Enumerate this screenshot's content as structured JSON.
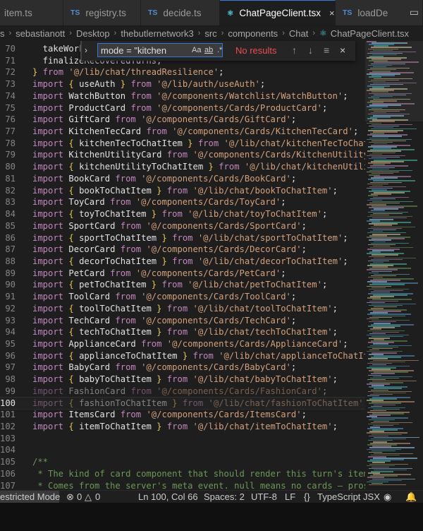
{
  "tabs": [
    {
      "label": "item.ts",
      "active": false
    },
    {
      "label": "registry.ts",
      "active": false
    },
    {
      "label": "decide.ts",
      "active": false
    },
    {
      "label": "ChatPageClient.tsx",
      "active": true
    },
    {
      "label": "loadDe",
      "active": false
    }
  ],
  "tab_close_glyph": "×",
  "breadcrumb": [
    "s",
    "sebastianott",
    "Desktop",
    "thebutlernetwork3",
    "src",
    "components",
    "Chat",
    "ChatPageClient.tsx"
  ],
  "find": {
    "query": "mode = \"kitchen",
    "result": "No results",
    "opt_case": "Aa",
    "opt_word": "ab",
    "opt_regex": ".*"
  },
  "lines": [
    {
      "n": 70,
      "code": [
        [
          "id",
          "  takeWork"
        ]
      ]
    },
    {
      "n": 71,
      "code": [
        [
          "id",
          "  finalizeRecoveredTurns,"
        ]
      ]
    },
    {
      "n": 72,
      "code": [
        [
          "br",
          "}"
        ],
        [
          "kw",
          " from "
        ],
        [
          "str",
          "'@/lib/chat/threadResilience'"
        ],
        [
          "id",
          ";"
        ]
      ]
    },
    {
      "n": 73,
      "code": [
        [
          "kw",
          "import "
        ],
        [
          "br",
          "{ "
        ],
        [
          "id",
          "useAuth "
        ],
        [
          "br",
          "}"
        ],
        [
          "kw",
          " from "
        ],
        [
          "str",
          "'@/lib/auth/useAuth'"
        ],
        [
          "id",
          ";"
        ]
      ]
    },
    {
      "n": 74,
      "code": [
        [
          "kw",
          "import "
        ],
        [
          "id",
          "WatchButton "
        ],
        [
          "kw",
          "from "
        ],
        [
          "str",
          "'@/components/Watchlist/WatchButton'"
        ],
        [
          "id",
          ";"
        ]
      ]
    },
    {
      "n": 75,
      "code": [
        [
          "kw",
          "import "
        ],
        [
          "id",
          "ProductCard "
        ],
        [
          "kw",
          "from "
        ],
        [
          "str",
          "'@/components/Cards/ProductCard'"
        ],
        [
          "id",
          ";"
        ]
      ]
    },
    {
      "n": 76,
      "code": [
        [
          "kw",
          "import "
        ],
        [
          "id",
          "GiftCard "
        ],
        [
          "kw",
          "from "
        ],
        [
          "str",
          "'@/components/Cards/GiftCard'"
        ],
        [
          "id",
          ";"
        ]
      ]
    },
    {
      "n": 77,
      "code": [
        [
          "kw",
          "import "
        ],
        [
          "id",
          "KitchenTecCard "
        ],
        [
          "kw",
          "from "
        ],
        [
          "str",
          "'@/components/Cards/KitchenTecCard'"
        ],
        [
          "id",
          ";"
        ]
      ]
    },
    {
      "n": 78,
      "code": [
        [
          "kw",
          "import "
        ],
        [
          "br",
          "{ "
        ],
        [
          "id",
          "kitchenTecToChatItem "
        ],
        [
          "br",
          "}"
        ],
        [
          "kw",
          " from "
        ],
        [
          "str",
          "'@/lib/chat/kitchenTecToChatItem'"
        ]
      ]
    },
    {
      "n": 79,
      "code": [
        [
          "kw",
          "import "
        ],
        [
          "id",
          "KitchenUtilityCard "
        ],
        [
          "kw",
          "from "
        ],
        [
          "str",
          "'@/components/Cards/KitchenUtilityCard'"
        ]
      ]
    },
    {
      "n": 80,
      "code": [
        [
          "kw",
          "import "
        ],
        [
          "br",
          "{ "
        ],
        [
          "id",
          "kitchenUtilityToChatItem "
        ],
        [
          "br",
          "}"
        ],
        [
          "kw",
          " from "
        ],
        [
          "str",
          "'@/lib/chat/kitchenUtilityToC"
        ]
      ]
    },
    {
      "n": 81,
      "code": [
        [
          "kw",
          "import "
        ],
        [
          "id",
          "BookCard "
        ],
        [
          "kw",
          "from "
        ],
        [
          "str",
          "'@/components/Cards/BookCard'"
        ],
        [
          "id",
          ";"
        ]
      ]
    },
    {
      "n": 82,
      "code": [
        [
          "kw",
          "import "
        ],
        [
          "br",
          "{ "
        ],
        [
          "id",
          "bookToChatItem "
        ],
        [
          "br",
          "}"
        ],
        [
          "kw",
          " from "
        ],
        [
          "str",
          "'@/lib/chat/bookToChatItem'"
        ],
        [
          "id",
          ";"
        ]
      ]
    },
    {
      "n": 83,
      "code": [
        [
          "kw",
          "import "
        ],
        [
          "id",
          "ToyCard "
        ],
        [
          "kw",
          "from "
        ],
        [
          "str",
          "'@/components/Cards/ToyCard'"
        ],
        [
          "id",
          ";"
        ]
      ]
    },
    {
      "n": 84,
      "code": [
        [
          "kw",
          "import "
        ],
        [
          "br",
          "{ "
        ],
        [
          "id",
          "toyToChatItem "
        ],
        [
          "br",
          "}"
        ],
        [
          "kw",
          " from "
        ],
        [
          "str",
          "'@/lib/chat/toyToChatItem'"
        ],
        [
          "id",
          ";"
        ]
      ]
    },
    {
      "n": 85,
      "code": [
        [
          "kw",
          "import "
        ],
        [
          "id",
          "SportCard "
        ],
        [
          "kw",
          "from "
        ],
        [
          "str",
          "'@/components/Cards/SportCard'"
        ],
        [
          "id",
          ";"
        ]
      ]
    },
    {
      "n": 86,
      "code": [
        [
          "kw",
          "import "
        ],
        [
          "br",
          "{ "
        ],
        [
          "id",
          "sportToChatItem "
        ],
        [
          "br",
          "}"
        ],
        [
          "kw",
          " from "
        ],
        [
          "str",
          "'@/lib/chat/sportToChatItem'"
        ],
        [
          "id",
          ";"
        ]
      ]
    },
    {
      "n": 87,
      "code": [
        [
          "kw",
          "import "
        ],
        [
          "id",
          "DecorCard "
        ],
        [
          "kw",
          "from "
        ],
        [
          "str",
          "'@/components/Cards/DecorCard'"
        ],
        [
          "id",
          ";"
        ]
      ]
    },
    {
      "n": 88,
      "code": [
        [
          "kw",
          "import "
        ],
        [
          "br",
          "{ "
        ],
        [
          "id",
          "decorToChatItem "
        ],
        [
          "br",
          "}"
        ],
        [
          "kw",
          " from "
        ],
        [
          "str",
          "'@/lib/chat/decorToChatItem'"
        ],
        [
          "id",
          ";"
        ]
      ]
    },
    {
      "n": 89,
      "code": [
        [
          "kw",
          "import "
        ],
        [
          "id",
          "PetCard "
        ],
        [
          "kw",
          "from "
        ],
        [
          "str",
          "'@/components/Cards/PetCard'"
        ],
        [
          "id",
          ";"
        ]
      ]
    },
    {
      "n": 90,
      "code": [
        [
          "kw",
          "import "
        ],
        [
          "br",
          "{ "
        ],
        [
          "id",
          "petToChatItem "
        ],
        [
          "br",
          "}"
        ],
        [
          "kw",
          " from "
        ],
        [
          "str",
          "'@/lib/chat/petToChatItem'"
        ],
        [
          "id",
          ";"
        ]
      ]
    },
    {
      "n": 91,
      "code": [
        [
          "kw",
          "import "
        ],
        [
          "id",
          "ToolCard "
        ],
        [
          "kw",
          "from "
        ],
        [
          "str",
          "'@/components/Cards/ToolCard'"
        ],
        [
          "id",
          ";"
        ]
      ]
    },
    {
      "n": 92,
      "code": [
        [
          "kw",
          "import "
        ],
        [
          "br",
          "{ "
        ],
        [
          "id",
          "toolToChatItem "
        ],
        [
          "br",
          "}"
        ],
        [
          "kw",
          " from "
        ],
        [
          "str",
          "'@/lib/chat/toolToChatItem'"
        ],
        [
          "id",
          ";"
        ]
      ]
    },
    {
      "n": 93,
      "code": [
        [
          "kw",
          "import "
        ],
        [
          "id",
          "TechCard "
        ],
        [
          "kw",
          "from "
        ],
        [
          "str",
          "'@/components/Cards/TechCard'"
        ],
        [
          "id",
          ";"
        ]
      ]
    },
    {
      "n": 94,
      "code": [
        [
          "kw",
          "import "
        ],
        [
          "br",
          "{ "
        ],
        [
          "id",
          "techToChatItem "
        ],
        [
          "br",
          "}"
        ],
        [
          "kw",
          " from "
        ],
        [
          "str",
          "'@/lib/chat/techToChatItem'"
        ],
        [
          "id",
          ";"
        ]
      ]
    },
    {
      "n": 95,
      "code": [
        [
          "kw",
          "import "
        ],
        [
          "id",
          "ApplianceCard "
        ],
        [
          "kw",
          "from "
        ],
        [
          "str",
          "'@/components/Cards/ApplianceCard'"
        ],
        [
          "id",
          ";"
        ]
      ]
    },
    {
      "n": 96,
      "code": [
        [
          "kw",
          "import "
        ],
        [
          "br",
          "{ "
        ],
        [
          "id",
          "applianceToChatItem "
        ],
        [
          "br",
          "}"
        ],
        [
          "kw",
          " from "
        ],
        [
          "str",
          "'@/lib/chat/applianceToChatItem'"
        ],
        [
          "id",
          ";"
        ]
      ]
    },
    {
      "n": 97,
      "code": [
        [
          "kw",
          "import "
        ],
        [
          "id",
          "BabyCard "
        ],
        [
          "kw",
          "from "
        ],
        [
          "str",
          "'@/components/Cards/BabyCard'"
        ],
        [
          "id",
          ";"
        ]
      ]
    },
    {
      "n": 98,
      "code": [
        [
          "kw",
          "import "
        ],
        [
          "br",
          "{ "
        ],
        [
          "id",
          "babyToChatItem "
        ],
        [
          "br",
          "}"
        ],
        [
          "kw",
          " from "
        ],
        [
          "str",
          "'@/lib/chat/babyToChatItem'"
        ],
        [
          "id",
          ";"
        ]
      ]
    },
    {
      "n": 99,
      "code": [
        [
          "kw",
          "import "
        ],
        [
          "id",
          "FashionCard "
        ],
        [
          "kw",
          "from "
        ],
        [
          "str",
          "'@/components/Cards/FashionCard'"
        ],
        [
          "id",
          ";"
        ]
      ],
      "dim": true
    },
    {
      "n": 100,
      "code": [
        [
          "kw",
          "import "
        ],
        [
          "br",
          "{ "
        ],
        [
          "id",
          "fashionToChatItem "
        ],
        [
          "br",
          "}"
        ],
        [
          "kw",
          " from "
        ],
        [
          "str",
          "'@/lib/chat/fashionToChatItem'"
        ],
        [
          "id",
          ";"
        ]
      ],
      "dim": true,
      "current": true
    },
    {
      "n": 101,
      "code": [
        [
          "kw",
          "import "
        ],
        [
          "id",
          "ItemsCard "
        ],
        [
          "kw",
          "from "
        ],
        [
          "str",
          "'@/components/Cards/ItemsCard'"
        ],
        [
          "id",
          ";"
        ]
      ]
    },
    {
      "n": 102,
      "code": [
        [
          "kw",
          "import "
        ],
        [
          "br",
          "{ "
        ],
        [
          "id",
          "itemToChatItem "
        ],
        [
          "br",
          "}"
        ],
        [
          "kw",
          " from "
        ],
        [
          "str",
          "'@/lib/chat/itemToChatItem'"
        ],
        [
          "id",
          ";"
        ]
      ]
    },
    {
      "n": 103,
      "code": []
    },
    {
      "n": 104,
      "code": []
    },
    {
      "n": 105,
      "code": [
        [
          "cm",
          "/**"
        ]
      ]
    },
    {
      "n": 106,
      "code": [
        [
          "cm",
          " * The kind of card component that should render this turn's items."
        ]
      ]
    },
    {
      "n": 107,
      "code": [
        [
          "cm",
          " * Comes from the server's meta event. null means no cards — prose onl"
        ]
      ]
    }
  ],
  "status": {
    "mode": "estricted Mode",
    "errors": "0",
    "warnings": "0",
    "position": "Ln 100, Col 66",
    "spaces": "Spaces: 2",
    "encoding": "UTF-8",
    "eol": "LF",
    "language": "TypeScript JSX"
  },
  "colors": {
    "accent": "#3a7be0",
    "keyword": "#c586c0",
    "string": "#d5a07a",
    "bracket": "#e6c84d",
    "comment": "#6a9955",
    "error": "#f14c4c"
  }
}
